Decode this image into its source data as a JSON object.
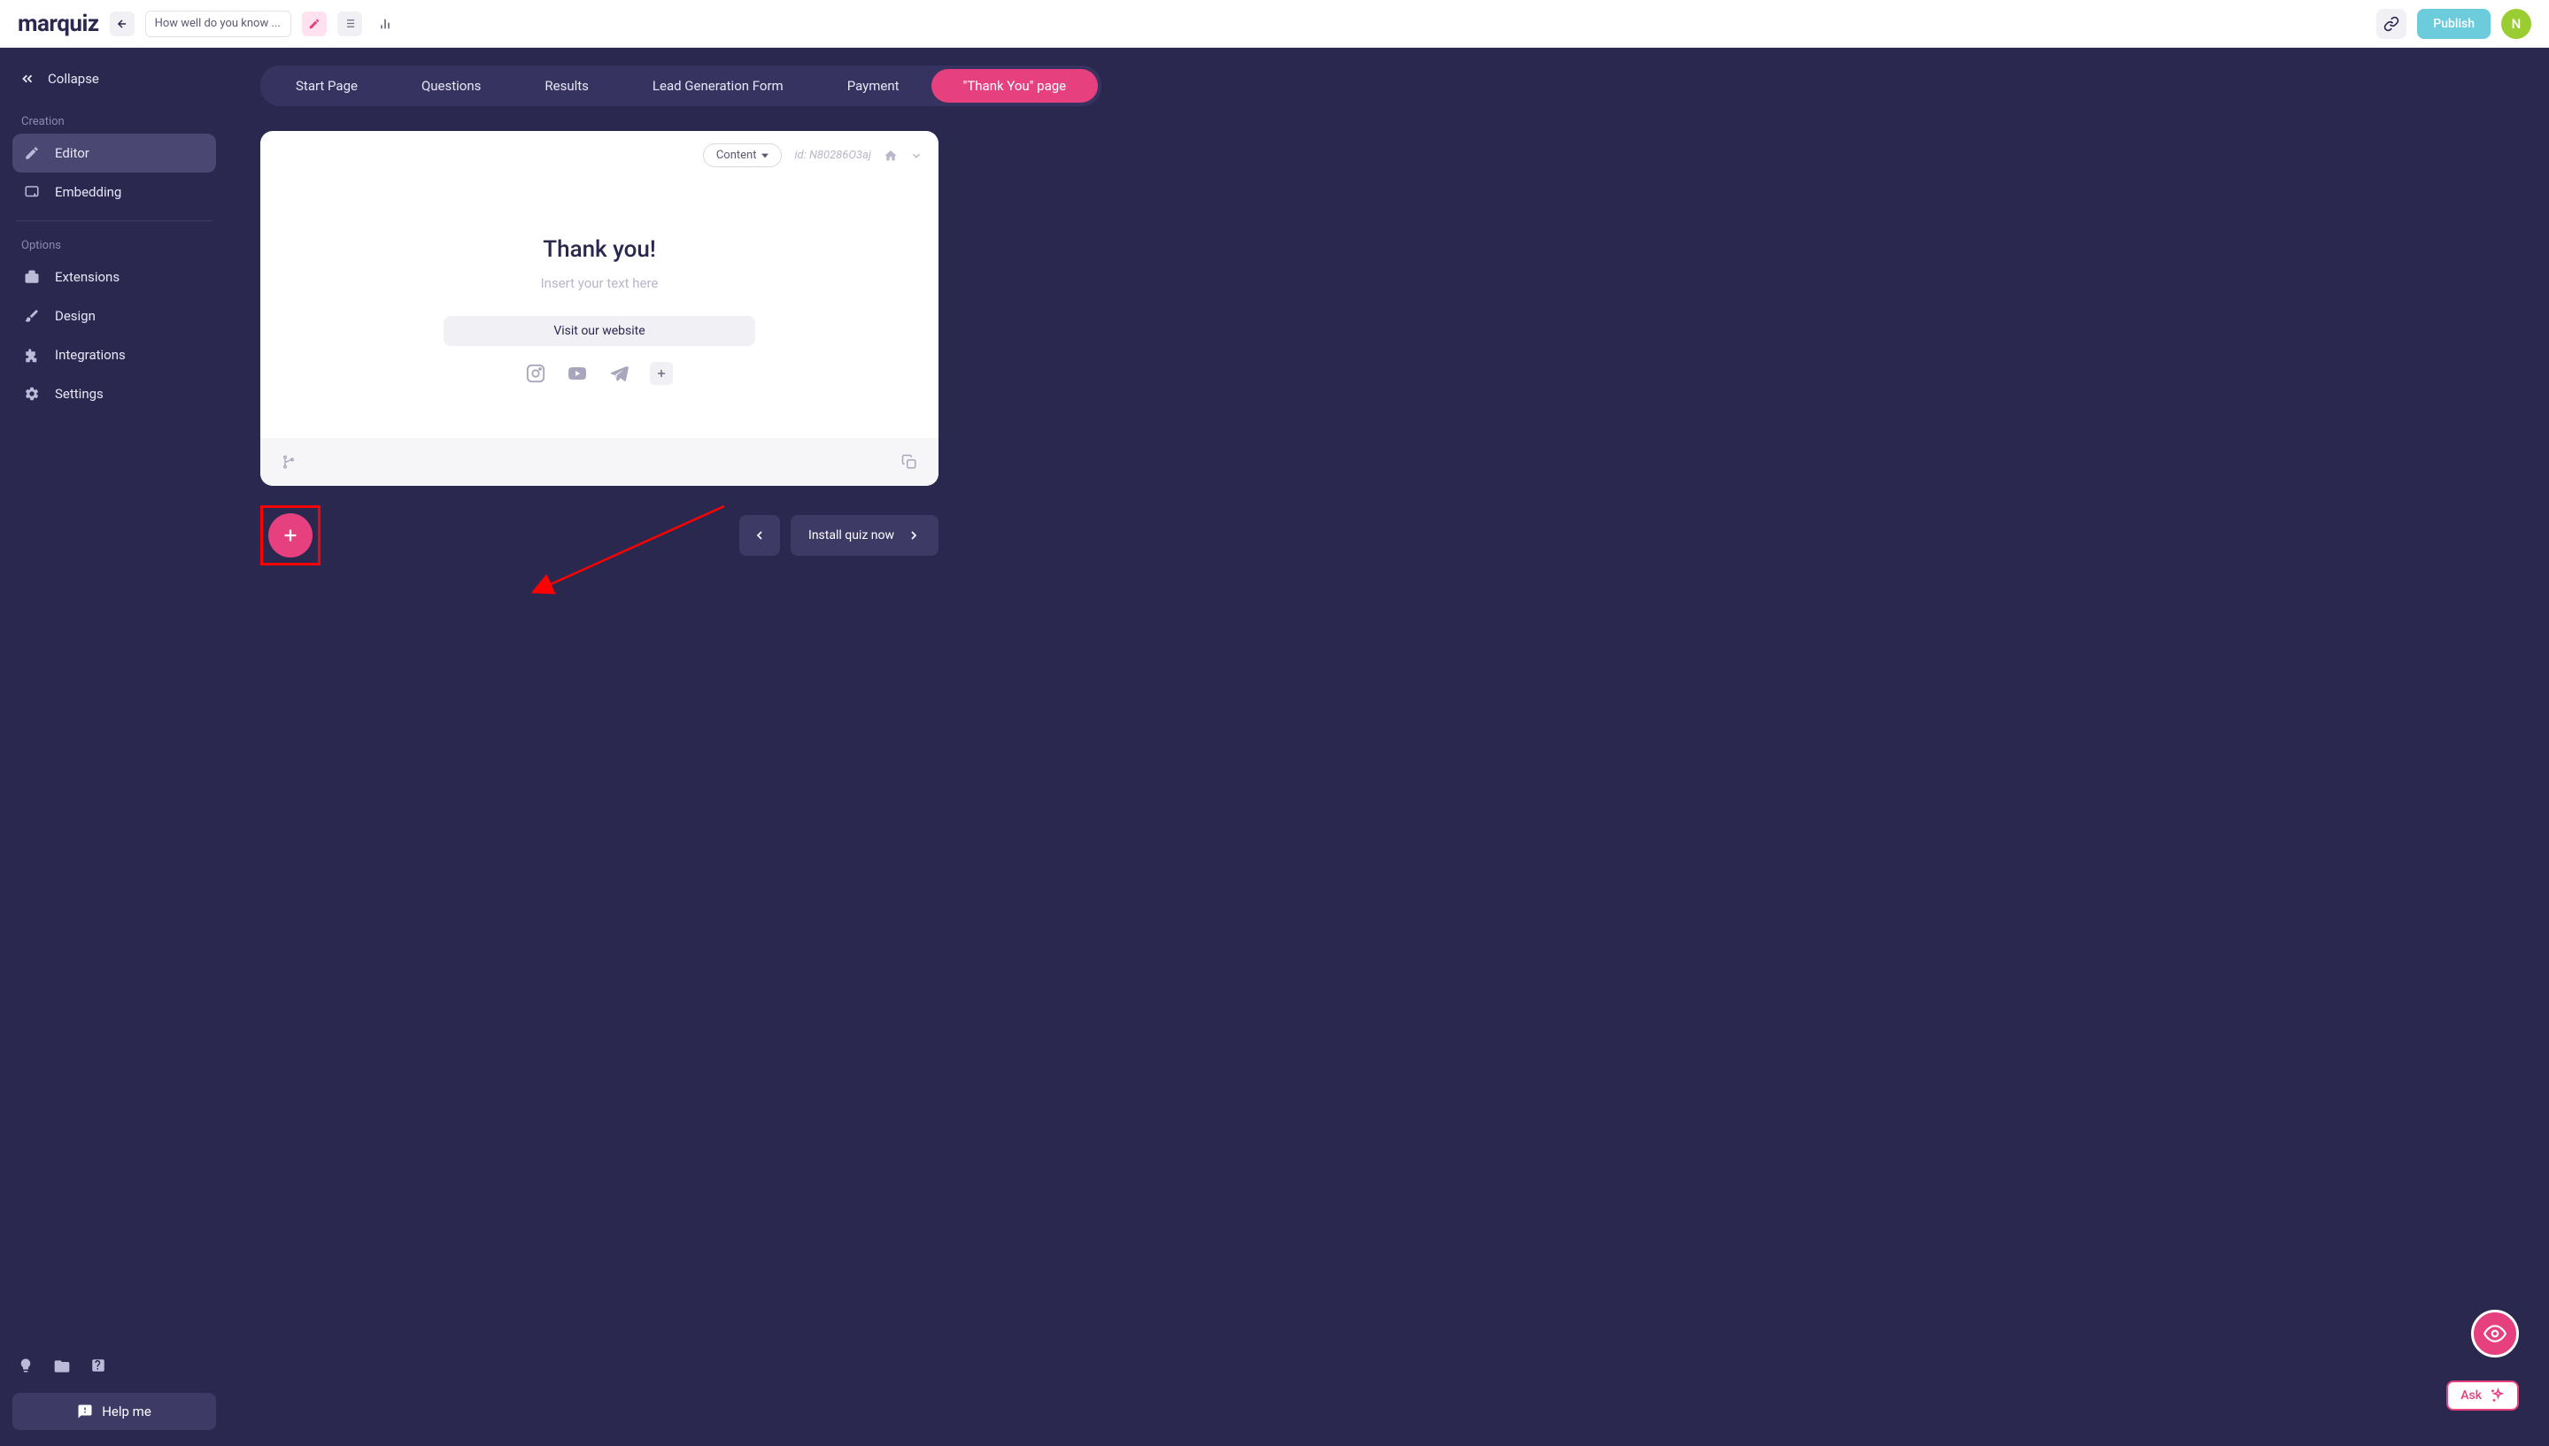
{
  "topbar": {
    "logo": "marquiz",
    "quiz_name": "How well do you know ...",
    "publish_label": "Publish",
    "avatar_letter": "N"
  },
  "sidebar": {
    "collapse_label": "Collapse",
    "section_creation": "Creation",
    "section_options": "Options",
    "items": {
      "editor": "Editor",
      "embedding": "Embedding",
      "extensions": "Extensions",
      "design": "Design",
      "integrations": "Integrations",
      "settings": "Settings"
    },
    "help_label": "Help me"
  },
  "tabs": {
    "start_page": "Start Page",
    "questions": "Questions",
    "results": "Results",
    "lead_form": "Lead Generation Form",
    "payment": "Payment",
    "thank_you": "\"Thank You\" page"
  },
  "card": {
    "content_dropdown": "Content",
    "id_label": "id: N80286O3aj",
    "title": "Thank you!",
    "placeholder": "Insert your text here",
    "visit_button": "Visit our website"
  },
  "nav": {
    "install_label": "Install quiz now"
  },
  "ask_label": "Ask"
}
